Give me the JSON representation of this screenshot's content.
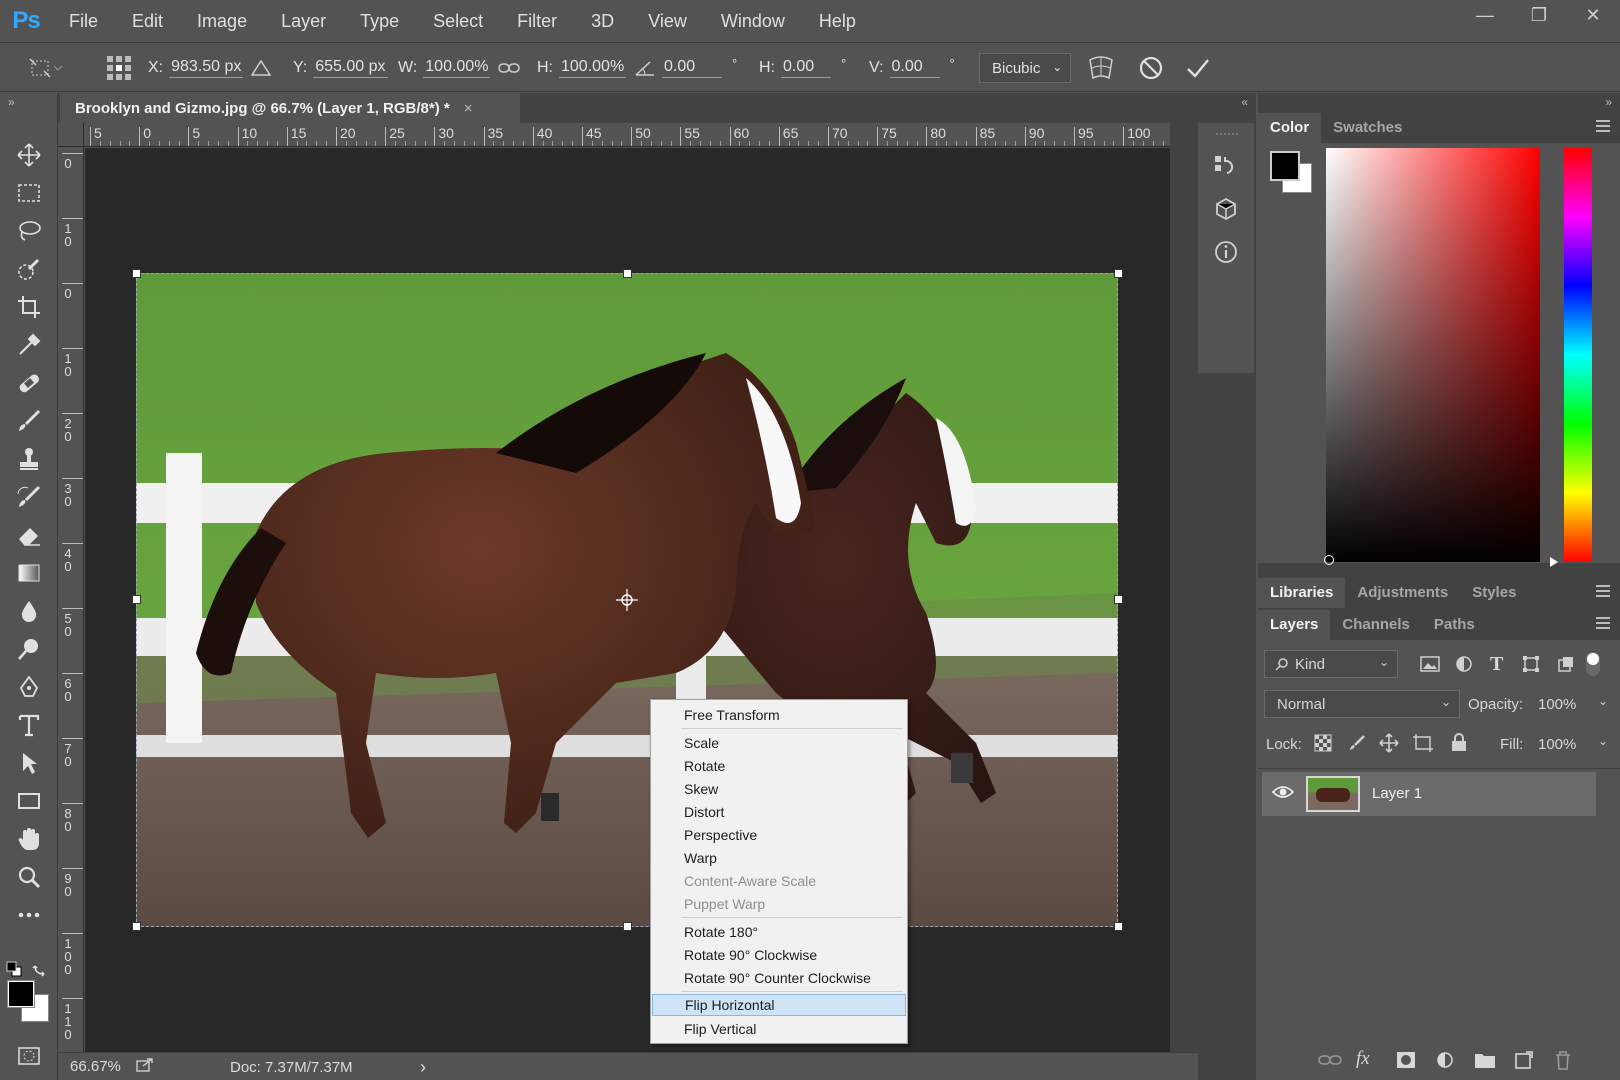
{
  "app": {
    "logo": "Ps"
  },
  "menu": [
    "File",
    "Edit",
    "Image",
    "Layer",
    "Type",
    "Select",
    "Filter",
    "3D",
    "View",
    "Window",
    "Help"
  ],
  "window_controls": {
    "minimize": "—",
    "restore": "❐",
    "close": "✕"
  },
  "options": {
    "x_label": "X:",
    "x_value": "983.50 px",
    "y_label": "Y:",
    "y_value": "655.00 px",
    "w_label": "W:",
    "w_value": "100.00%",
    "h_label": "H:",
    "h_value": "100.00%",
    "angle_value": "0.00",
    "angle_unit": "°",
    "hskew_label": "H:",
    "hskew_value": "0.00",
    "hskew_unit": "°",
    "vskew_label": "V:",
    "vskew_value": "0.00",
    "vskew_unit": "°",
    "interpolation": "Bicubic"
  },
  "document": {
    "tab_title": "Brooklyn and Gizmo.jpg @ 66.7% (Layer 1, RGB/8*) *",
    "tab_close": "×",
    "ruler_top": [
      "5",
      "0",
      "5",
      "10",
      "15",
      "20",
      "25",
      "30",
      "35",
      "40",
      "45",
      "50",
      "55",
      "60",
      "65",
      "70",
      "75",
      "80",
      "85",
      "90",
      "95",
      "100"
    ],
    "ruler_left": [
      "0",
      "10",
      "0",
      "10",
      "20",
      "30",
      "40",
      "50",
      "60",
      "70",
      "80",
      "90",
      "100",
      "110"
    ]
  },
  "context_menu": {
    "items": [
      {
        "label": "Free Transform",
        "enabled": true
      },
      {
        "label": "Scale",
        "enabled": true
      },
      {
        "label": "Rotate",
        "enabled": true
      },
      {
        "label": "Skew",
        "enabled": true
      },
      {
        "label": "Distort",
        "enabled": true
      },
      {
        "label": "Perspective",
        "enabled": true
      },
      {
        "label": "Warp",
        "enabled": true
      },
      {
        "label": "Content-Aware Scale",
        "enabled": false
      },
      {
        "label": "Puppet Warp",
        "enabled": false
      },
      {
        "label": "Rotate 180°",
        "enabled": true
      },
      {
        "label": "Rotate 90° Clockwise",
        "enabled": true
      },
      {
        "label": "Rotate 90° Counter Clockwise",
        "enabled": true
      },
      {
        "label": "Flip Horizontal",
        "enabled": true,
        "highlighted": true
      },
      {
        "label": "Flip Vertical",
        "enabled": true
      }
    ]
  },
  "status": {
    "zoom": "66.67%",
    "doc": "Doc: 7.37M/7.37M",
    "arrow": "›"
  },
  "panels": {
    "color_tabs": [
      "Color",
      "Swatches"
    ],
    "lib_tabs": [
      "Libraries",
      "Adjustments",
      "Styles"
    ],
    "layer_tabs": [
      "Layers",
      "Channels",
      "Paths"
    ],
    "kind": "Kind",
    "blend_mode": "Normal",
    "opacity_label": "Opacity:",
    "opacity_value": "100%",
    "lock_label": "Lock:",
    "fill_label": "Fill:",
    "fill_value": "100%",
    "layer_name": "Layer 1",
    "bottom_fx": "fx"
  },
  "colors": {
    "foreground": "#000000",
    "background": "#ffffff",
    "picker_hue": "#ff0000",
    "menu_highlight": "#cfe3f7",
    "ps_blue": "#31a8ff"
  }
}
